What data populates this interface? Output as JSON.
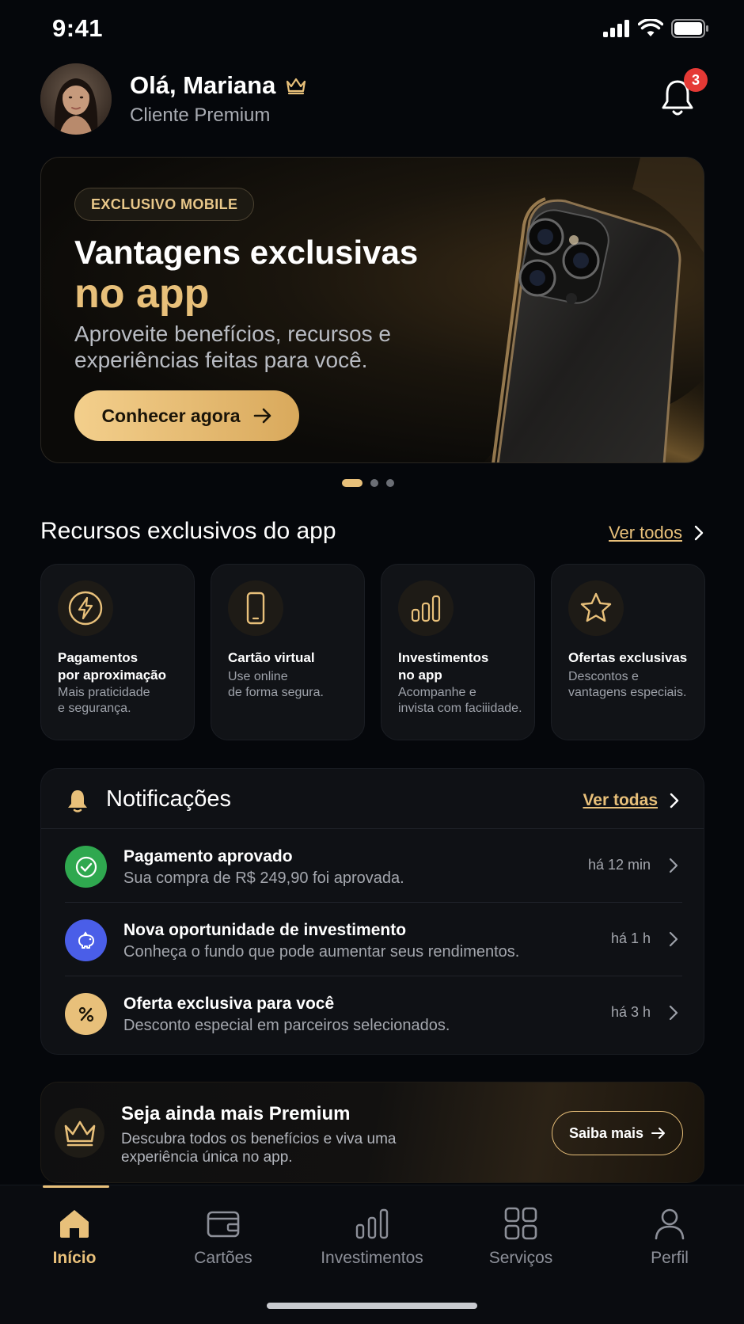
{
  "status_bar": {
    "time": "9:41"
  },
  "header": {
    "greeting": "Olá, Mariana",
    "subtitle": "Cliente Premium",
    "notification_count": "3"
  },
  "banner": {
    "pill": "EXCLUSIVO MOBILE",
    "title_line1": "Vantagens exclusivas",
    "title_line2": "no app",
    "description": "Aproveite benefícios, recursos e experiências feitas para você.",
    "cta_label": "Conhecer agora",
    "carousel_active_index": 0,
    "carousel_count": 3
  },
  "features_section": {
    "title": "Recursos exclusivos do app",
    "see_all": "Ver todos",
    "items": [
      {
        "icon": "lightning-icon",
        "title": "Pagamentos\npor aproximação",
        "desc": "Mais praticidade\ne segurança."
      },
      {
        "icon": "smartphone-icon",
        "title": "Cartão virtual",
        "desc": "Use online\nde forma segura."
      },
      {
        "icon": "bar-chart-icon",
        "title": "Investimentos\nno app",
        "desc": "Acompanhe e\ninvista com faciiidade."
      },
      {
        "icon": "star-icon",
        "title": "Ofertas exclusivas",
        "desc": "Descontos e\nvantagens especiais."
      }
    ]
  },
  "notifications": {
    "title": "Notificações",
    "see_all": "Ver todas",
    "items": [
      {
        "icon": "check-circle-icon",
        "color": "#2fa84f",
        "title": "Pagamento aprovado",
        "desc": "Sua compra de R$ 249,90 foi aprovada.",
        "time": "há 12 min"
      },
      {
        "icon": "piggy-bank-icon",
        "color": "#4a5ee8",
        "title": "Nova oportunidade de investimento",
        "desc": "Conheça o fundo que pode aumentar seus rendimentos.",
        "time": "há 1 h"
      },
      {
        "icon": "percent-icon",
        "color": "#e8c07a",
        "title": "Oferta exclusiva para você",
        "desc": "Desconto especial em parceiros selecionados.",
        "time": "há 3 h"
      }
    ]
  },
  "premium": {
    "title": "Seja ainda mais Premium",
    "desc": "Descubra todos os benefícios e viva uma experiência única no app.",
    "button": "Saiba mais"
  },
  "tabbar": {
    "items": [
      {
        "icon": "home-icon",
        "label": "Início",
        "active": true
      },
      {
        "icon": "wallet-icon",
        "label": "Cartões",
        "active": false
      },
      {
        "icon": "bar-chart-icon",
        "label": "Investimentos",
        "active": false
      },
      {
        "icon": "grid-icon",
        "label": "Serviços",
        "active": false
      },
      {
        "icon": "user-icon",
        "label": "Perfil",
        "active": false
      }
    ]
  },
  "colors": {
    "accent": "#e8c07a",
    "background": "#05070b",
    "card": "#111317"
  }
}
